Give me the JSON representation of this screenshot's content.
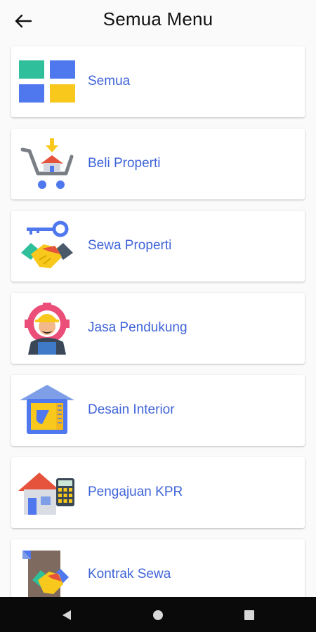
{
  "header": {
    "title": "Semua Menu"
  },
  "menu": {
    "items": [
      {
        "label": "Semua",
        "icon": "grid-icon"
      },
      {
        "label": "Beli Properti",
        "icon": "shopping-cart-house-icon"
      },
      {
        "label": "Sewa Properti",
        "icon": "key-handshake-icon"
      },
      {
        "label": "Jasa Pendukung",
        "icon": "worker-gear-icon"
      },
      {
        "label": "Desain Interior",
        "icon": "house-blueprint-icon"
      },
      {
        "label": "Pengajuan KPR",
        "icon": "house-calculator-icon"
      },
      {
        "label": "Kontrak Sewa",
        "icon": "contract-handshake-icon"
      }
    ]
  },
  "colors": {
    "label": "#3f64d8",
    "navbar": "#0a0a0a"
  }
}
